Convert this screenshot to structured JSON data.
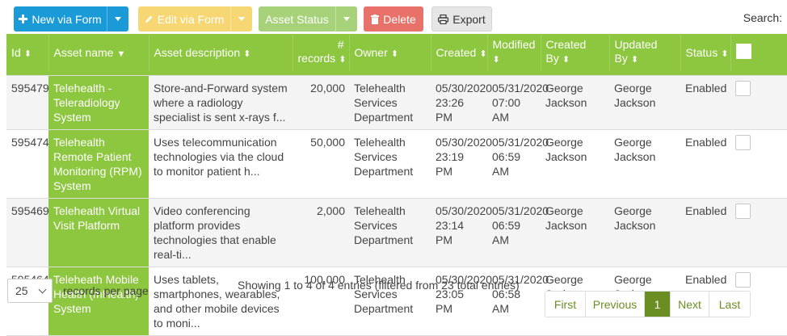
{
  "colors": {
    "blue": "#1a9bd7",
    "yellow": "#f7d774",
    "green": "#a7d27a",
    "red": "#e8726a",
    "gray": "#e6e6e6",
    "header": "#8dc63f",
    "pager_active": "#6b8e23"
  },
  "toolbar": {
    "new_label": "New via Form",
    "new_icon": "plus-icon",
    "edit_label": "Edit via Form",
    "edit_icon": "pencil-icon",
    "status_label": "Asset Status",
    "delete_label": "Delete",
    "delete_icon": "trash-icon",
    "export_label": "Export",
    "export_icon": "printer-icon",
    "search_label": "Search:"
  },
  "table": {
    "headers": {
      "id": "Id",
      "name": "Asset name",
      "description": "Asset description",
      "records_hash": "#",
      "records": "records",
      "owner": "Owner",
      "created": "Created",
      "modified": "Modified",
      "created_by_1": "Created",
      "created_by_2": "By",
      "updated_by_1": "Updated",
      "updated_by_2": "By",
      "status": "Status"
    },
    "rows": [
      {
        "id": "595479",
        "name": "Telehealth - Teleradiology System",
        "description": "Store-and-Forward system where a radiology specialist is sent x-rays f...",
        "records": "20,000",
        "owner": "Telehealth Services Department",
        "created": "05/30/2020 23:26 PM",
        "modified": "05/31/2020 07:00 AM",
        "created_by": "George Jackson",
        "updated_by": "George Jackson",
        "status": "Enabled"
      },
      {
        "id": "595474",
        "name": "Telehealth Remote Patient Monitoring (RPM) System",
        "description": "Uses telecommunication technologies via the cloud to monitor patient h...",
        "records": "50,000",
        "owner": "Telehealth Services Department",
        "created": "05/30/2020 23:19 PM",
        "modified": "05/31/2020 06:59 AM",
        "created_by": "George Jackson",
        "updated_by": "George Jackson",
        "status": "Enabled"
      },
      {
        "id": "595469",
        "name": "Telehealth Virtual Visit Platform",
        "description": "Video conferencing platform provides technologies that enable real-ti...",
        "records": "2,000",
        "owner": "Telehealth Services Department",
        "created": "05/30/2020 23:14 PM",
        "modified": "05/31/2020 06:59 AM",
        "created_by": "George Jackson",
        "updated_by": "George Jackson",
        "status": "Enabled"
      },
      {
        "id": "595464",
        "name": "Teleheath Mobile Health (mHealth) System",
        "description": "Uses tablets, smartphones, wearables, and other mobile devices to moni...",
        "records": "100,000",
        "owner": "Telehealth Services Department",
        "created": "05/30/2020 23:05 PM",
        "modified": "05/31/2020 06:58 AM",
        "created_by": "George Jackson",
        "updated_by": "George Jackson",
        "status": "Enabled"
      }
    ]
  },
  "footer": {
    "page_size": "25",
    "records_per_page": "records per page",
    "info": "Showing 1 to 4 of 4 entries (filtered from 23 total entries)",
    "pager": {
      "first": "First",
      "previous": "Previous",
      "current": "1",
      "next": "Next",
      "last": "Last"
    }
  }
}
